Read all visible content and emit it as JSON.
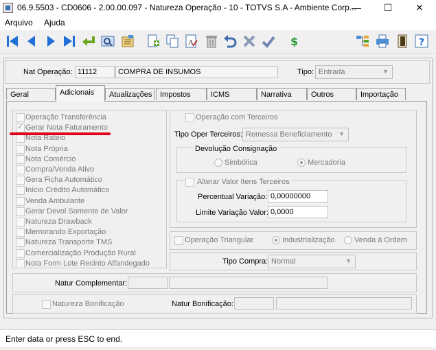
{
  "window": {
    "title": "06.9.5503 - CD0606 - 2.00.00.097 - Natureza Operação - 10 - TOTVS S.A - Ambiente Corp...",
    "minimize": "—",
    "maximize": "☐",
    "close": "✕"
  },
  "menu": {
    "items": [
      "Arquivo",
      "Ajuda"
    ]
  },
  "toolbar": {
    "buttons": [
      "first-icon",
      "prev-icon",
      "next-icon",
      "last-icon",
      "goto-icon",
      "search-icon",
      "list-icon",
      "add-icon",
      "copy-icon",
      "edit-icon",
      "delete-icon",
      "undo-icon",
      "cancel-icon",
      "confirm-icon",
      "dollar-icon",
      "tree-icon",
      "print-icon",
      "exit-icon",
      "help-icon"
    ]
  },
  "header": {
    "nat_label": "Nat Operação:",
    "nat_code": "11112",
    "nat_desc": "COMPRA DE INSUMOS",
    "tipo_label": "Tipo:",
    "tipo_value": "Entrada"
  },
  "tabs": [
    "Geral",
    "Adicionais",
    "Atualizações",
    "Impostos",
    "ICMS",
    "Narrativa",
    "Outros",
    "Importação"
  ],
  "active_tab": "Adicionais",
  "left_checks": [
    {
      "label": "Operação Transferência",
      "checked": false
    },
    {
      "label": "Gerar Nota Faturamento",
      "checked": true
    },
    {
      "label": "Nota Rateio",
      "checked": false
    },
    {
      "label": "Nota Própria",
      "checked": false
    },
    {
      "label": "Nota Comércio",
      "checked": false
    },
    {
      "label": "Compra/Venda Ativo",
      "checked": false
    },
    {
      "label": "Gera Ficha Automático",
      "checked": false
    },
    {
      "label": "Início Crédito Automático",
      "checked": false
    },
    {
      "label": "Venda Ambulante",
      "checked": false
    },
    {
      "label": "Gerar Devol Somente de Valor",
      "checked": false
    },
    {
      "label": "Natureza Drawback",
      "checked": false
    },
    {
      "label": "Memorando Exportação",
      "checked": false
    },
    {
      "label": "Natureza Transporte TMS",
      "checked": false
    },
    {
      "label": "Comercialização Produção Rural",
      "checked": false
    },
    {
      "label": "Nota Form Lote Recinto Alfandegado",
      "checked": false
    }
  ],
  "terceiros": {
    "op_label": "Operação com Terceiros",
    "tipo_label": "Tipo Oper Terceiros:",
    "tipo_value": "Remessa Beneficiamento",
    "devol_title": "Devolução Consignação",
    "radio_simbolica": "Simbólica",
    "radio_mercadoria": "Mercadoria",
    "alterar_label": "Alterar Valor Itens Terceiros",
    "perc_label": "Percentual Variação:",
    "perc_value": "0,00000000",
    "limite_label": "Limite Variação Valor:",
    "limite_value": "0,0000"
  },
  "triangular": {
    "label": "Operação Triangular",
    "radio_industrializacao": "Industrialização",
    "radio_venda": "Venda à Ordem"
  },
  "compra": {
    "label": "Tipo Compra:",
    "value": "Normal"
  },
  "complementar": {
    "label": "Natur Complementar:"
  },
  "bonificacao": {
    "check_label": "Natureza Bonificação",
    "label": "Natur Bonificação:"
  },
  "status": {
    "text": "Enter data or press ESC to end."
  }
}
